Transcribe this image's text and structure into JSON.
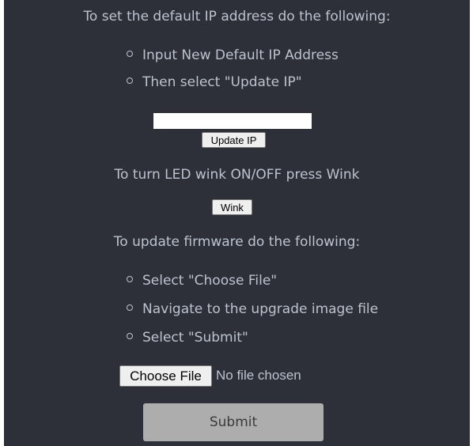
{
  "ip_section": {
    "heading": "To set the default IP address do the following:",
    "steps": [
      "Input New Default IP Address",
      "Then select \"Update IP\""
    ],
    "ip_input_value": "",
    "update_button_label": "Update IP"
  },
  "wink_section": {
    "heading": "To turn LED wink ON/OFF press Wink",
    "wink_button_label": "Wink"
  },
  "firmware_section": {
    "heading": "To update firmware do the following:",
    "steps": [
      "Select \"Choose File\"",
      "Navigate to the upgrade image file",
      "Select \"Submit\""
    ],
    "choose_file_label": "Choose File",
    "file_status": "No file chosen",
    "submit_label": "Submit"
  },
  "colors": {
    "background": "#2d3039",
    "text": "#bcc3cf",
    "submit_button": "#adadad"
  }
}
